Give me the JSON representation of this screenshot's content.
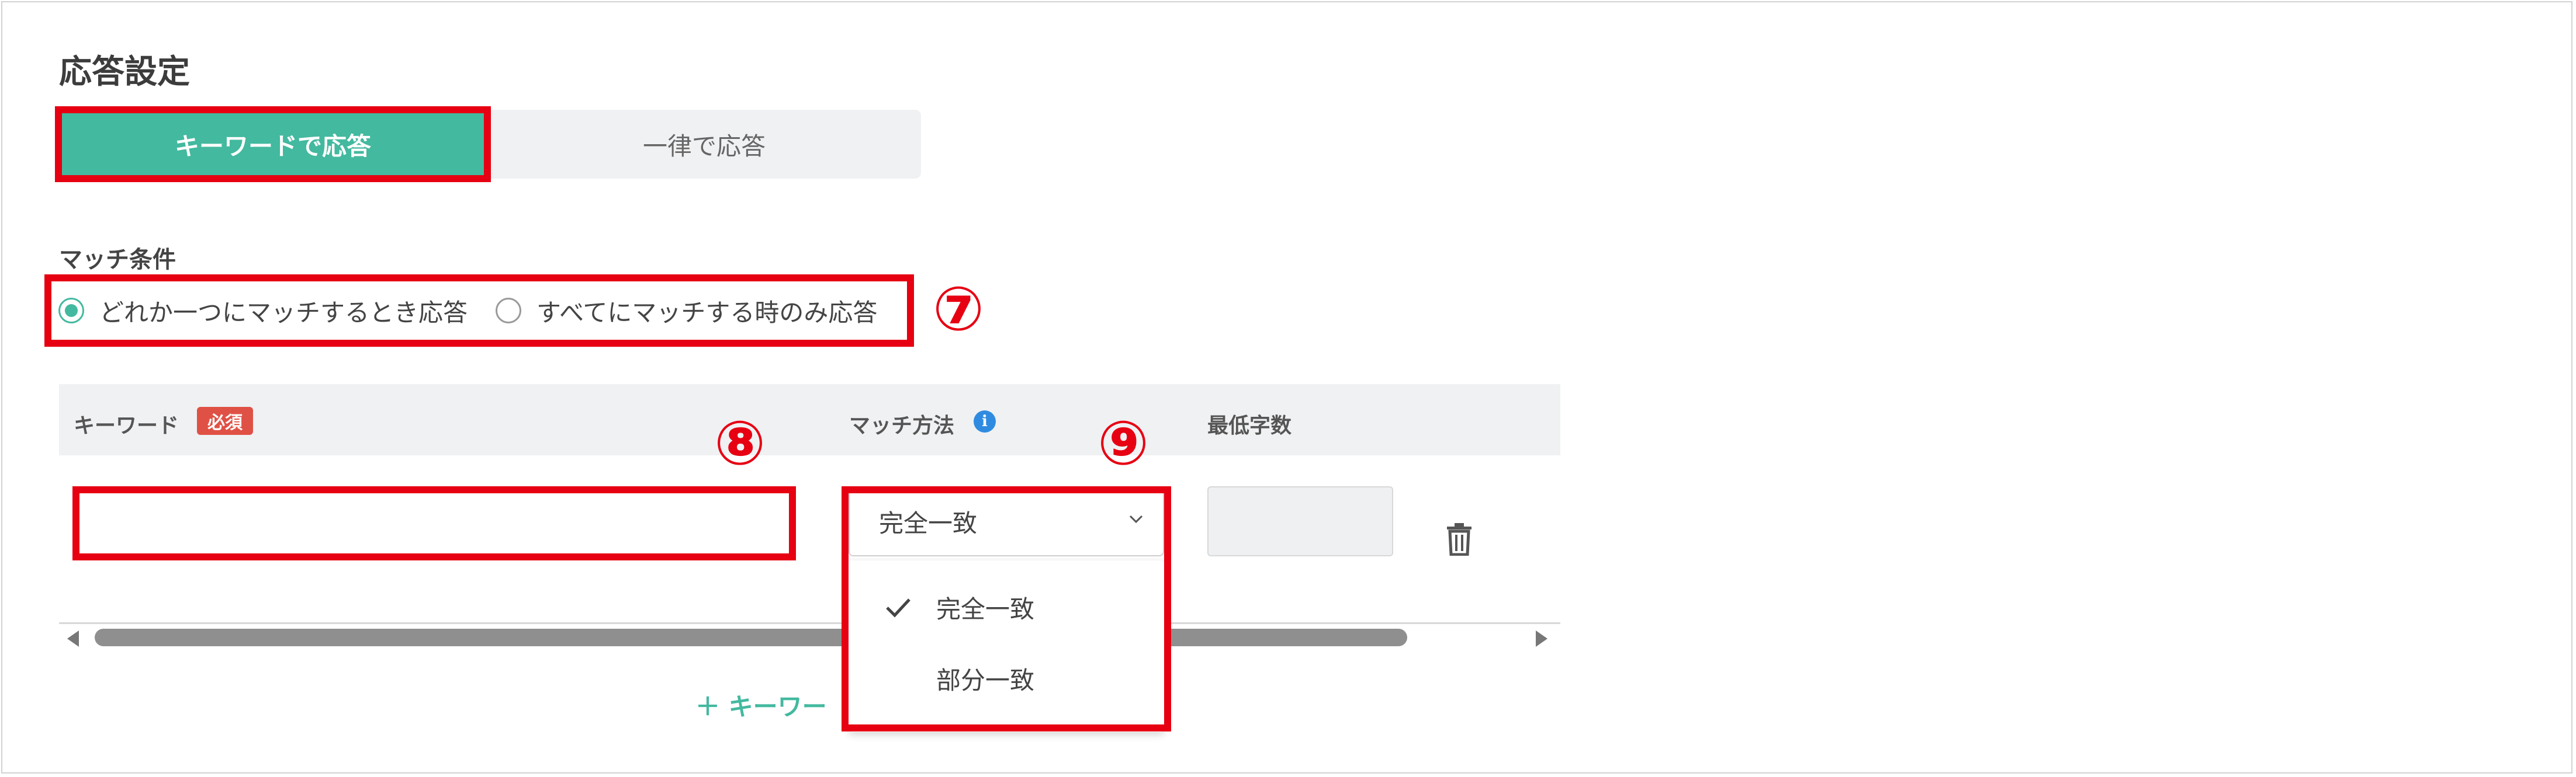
{
  "section_title": "応答設定",
  "response_mode": {
    "tabs": [
      {
        "label": "キーワードで応答",
        "active": true
      },
      {
        "label": "一律で応答",
        "active": false
      }
    ]
  },
  "match_condition": {
    "label": "マッチ条件",
    "options": [
      {
        "label": "どれか一つにマッチするとき応答",
        "checked": true
      },
      {
        "label": "すべてにマッチする時のみ応答",
        "checked": false
      }
    ]
  },
  "keyword_table": {
    "headers": {
      "keyword": "キーワード",
      "required_badge": "必須",
      "match_method": "マッチ方法",
      "min_chars": "最低字数"
    },
    "info_icon": "i",
    "row": {
      "keyword_value": "",
      "match_method_value": "完全一致",
      "min_chars_value": ""
    }
  },
  "match_method_dropdown": {
    "options": [
      {
        "label": "完全一致",
        "selected": true
      },
      {
        "label": "部分一致",
        "selected": false
      }
    ]
  },
  "add_keyword_label": "＋ キーワー",
  "annotations": {
    "n7": "⑦",
    "n8": "⑧",
    "n9": "⑨"
  },
  "icons": {
    "trash": "trash-icon",
    "chevron": "chevron-down-icon",
    "check": "check-icon"
  },
  "colors": {
    "accent": "#43b99f",
    "highlight": "#e60012",
    "required_badge": "#e05145",
    "info": "#2f8be0"
  }
}
